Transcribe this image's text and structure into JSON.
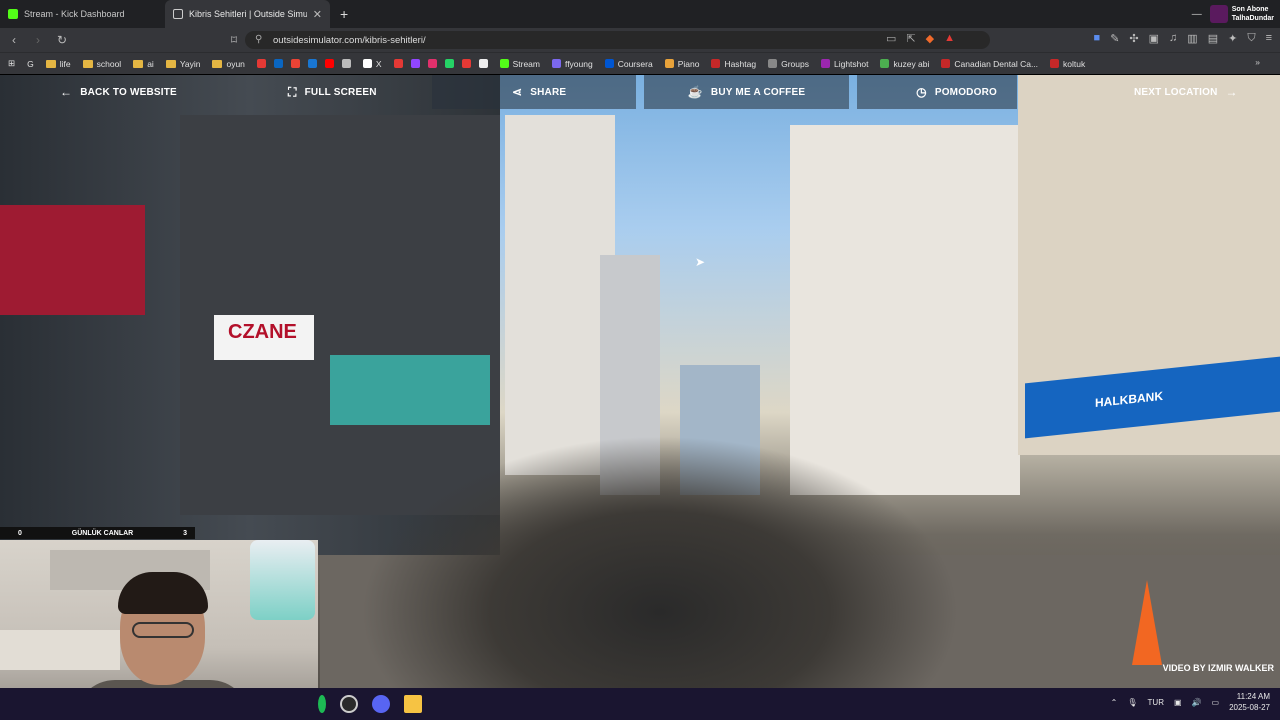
{
  "browser": {
    "tabs": [
      {
        "title": "Stream - Kick Dashboard",
        "active": false
      },
      {
        "title": "Kibris Sehitleri | Outside Simu",
        "active": true
      }
    ],
    "url": "outsidesimulator.com/kibris-sehitleri/"
  },
  "stream_overlay": {
    "abone_label": "Son Abone",
    "abone_name": "TalhaDundar",
    "cam_left_count": "0",
    "cam_label": "GÜNLÜK CANLAR",
    "cam_right_count": "3"
  },
  "bookmarks": [
    {
      "label": "life",
      "type": "folder"
    },
    {
      "label": "school",
      "type": "folder"
    },
    {
      "label": "ai",
      "type": "folder"
    },
    {
      "label": "Yayin",
      "type": "folder"
    },
    {
      "label": "oyun",
      "type": "folder"
    },
    {
      "label": "X",
      "type": "site",
      "color": "#000000"
    },
    {
      "label": "Stream",
      "type": "site",
      "color": "#53fc18"
    },
    {
      "label": "ffyoung",
      "type": "site",
      "color": "#7b68ee"
    },
    {
      "label": "Coursera",
      "type": "site",
      "color": "#0056d2"
    },
    {
      "label": "Piano",
      "type": "site",
      "color": "#e8a23a"
    },
    {
      "label": "Hashtag",
      "type": "site",
      "color": "#c62828"
    },
    {
      "label": "Groups",
      "type": "site",
      "color": "#888888"
    },
    {
      "label": "Lightshot",
      "type": "site",
      "color": "#9c27b0"
    },
    {
      "label": "kuzey abi",
      "type": "site",
      "color": "#4caf50"
    },
    {
      "label": "Canadian Dental Ca...",
      "type": "site",
      "color": "#c62828"
    },
    {
      "label": "koltuk",
      "type": "site",
      "color": "#c62828"
    }
  ],
  "site_nav": {
    "back": "BACK TO WEBSITE",
    "fullscreen": "FULL SCREEN",
    "share": "SHARE",
    "coffee": "BUY ME A COFFEE",
    "pomodoro": "POMODORO",
    "next": "NEXT LOCATION"
  },
  "video": {
    "credit": "VIDEO BY IZMIR WALKER",
    "signs": {
      "halkbank": "HALKBANK",
      "eczane": "CZANE"
    }
  },
  "taskbar": {
    "lang": "TUR",
    "time": "11:24 AM",
    "date": "2025-08-27"
  },
  "colors": {
    "accent_kick": "#53fc18",
    "browser_dark": "#202124",
    "taskbar": "#1a1530",
    "halkbank_blue": "#1565c0"
  }
}
